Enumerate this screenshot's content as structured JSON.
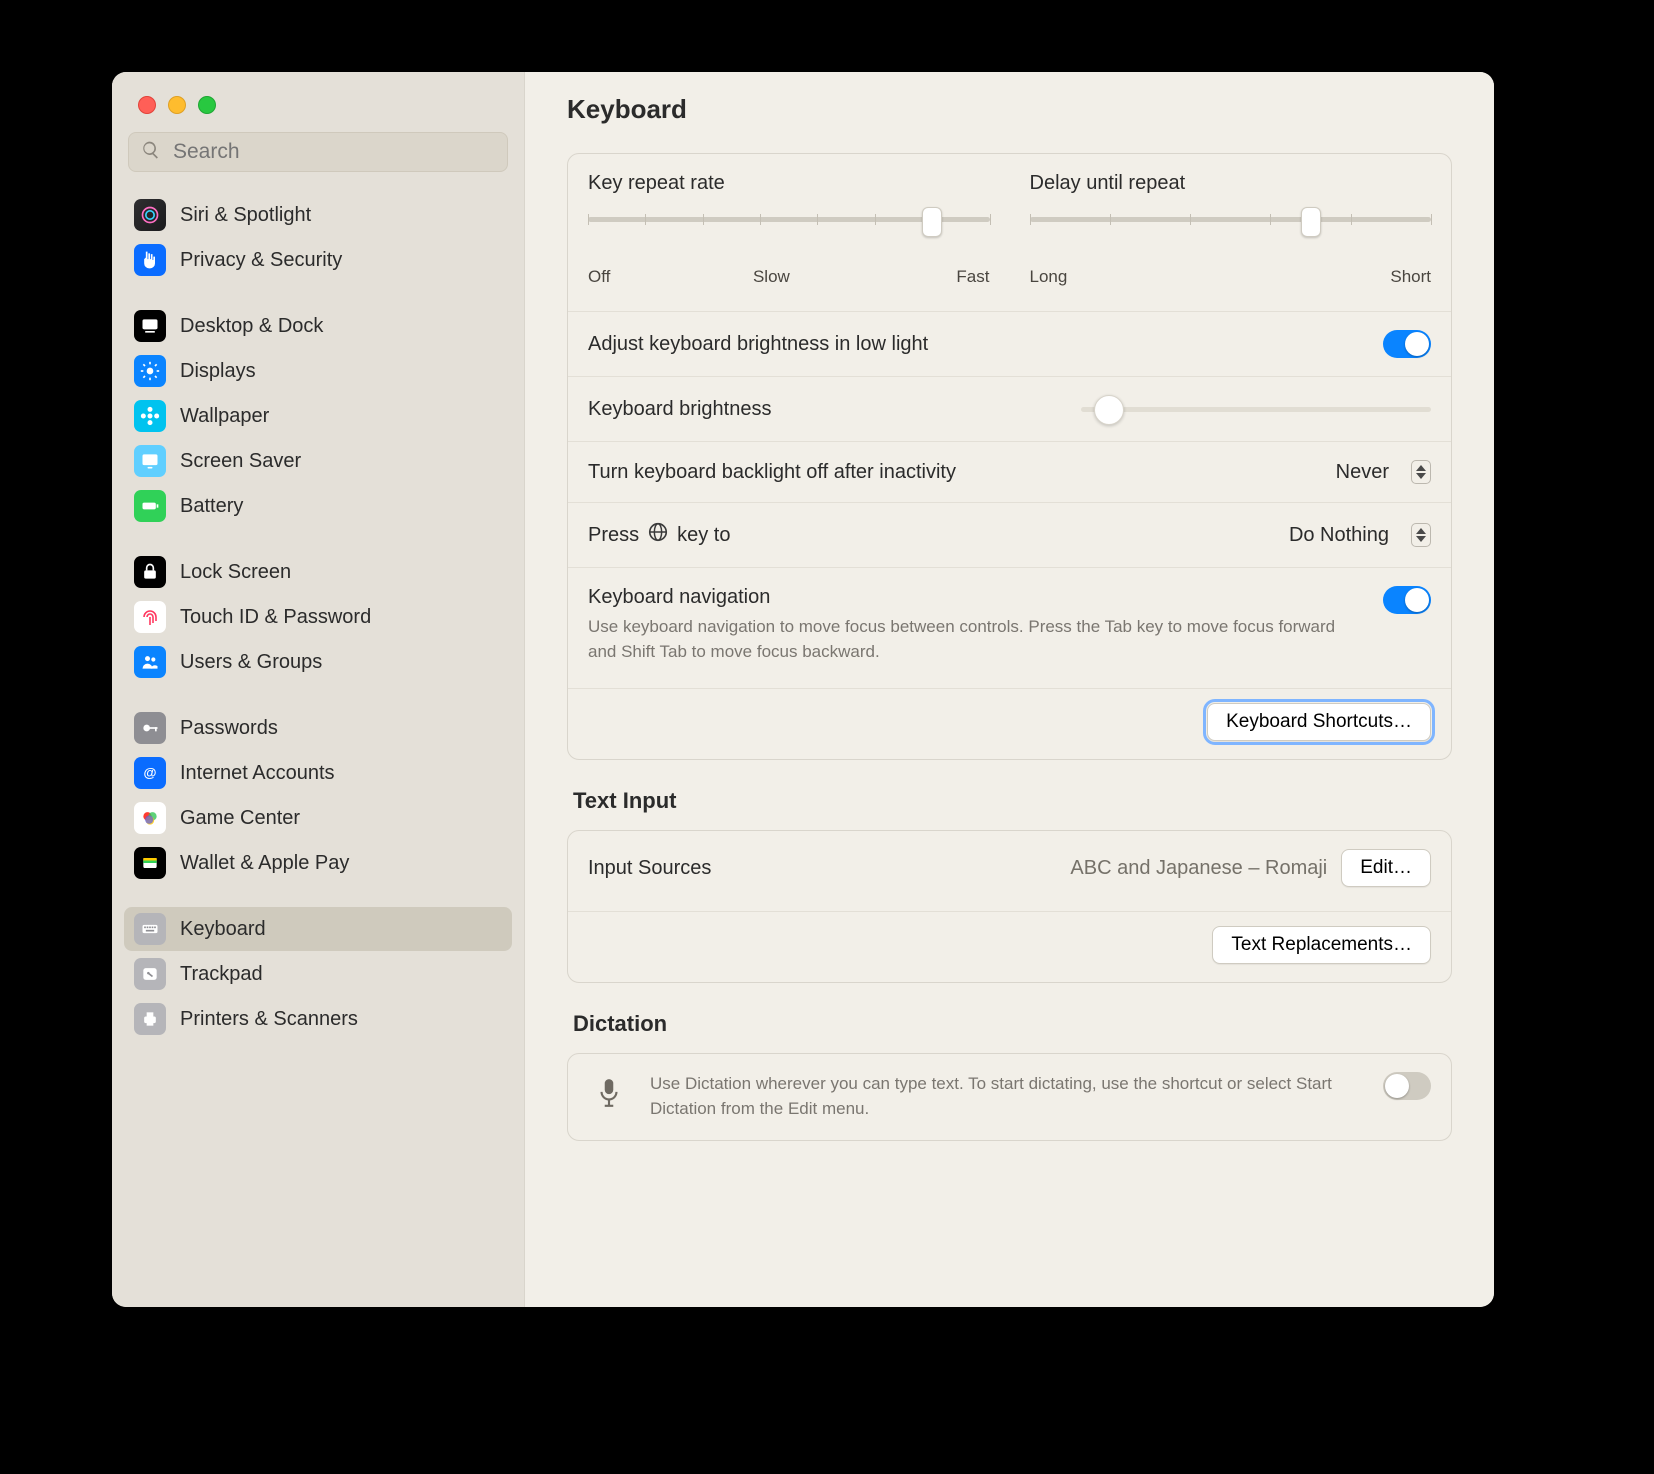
{
  "header": {
    "title": "Keyboard"
  },
  "search": {
    "placeholder": "Search"
  },
  "sidebar": {
    "groups": [
      {
        "items": [
          {
            "id": "siri",
            "label": "Siri & Spotlight"
          },
          {
            "id": "privacy",
            "label": "Privacy & Security"
          }
        ]
      },
      {
        "items": [
          {
            "id": "desktop",
            "label": "Desktop & Dock"
          },
          {
            "id": "displays",
            "label": "Displays"
          },
          {
            "id": "wallpaper",
            "label": "Wallpaper"
          },
          {
            "id": "screensaver",
            "label": "Screen Saver"
          },
          {
            "id": "battery",
            "label": "Battery"
          }
        ]
      },
      {
        "items": [
          {
            "id": "lock",
            "label": "Lock Screen"
          },
          {
            "id": "touchid",
            "label": "Touch ID & Password"
          },
          {
            "id": "users",
            "label": "Users & Groups"
          }
        ]
      },
      {
        "items": [
          {
            "id": "passwords",
            "label": "Passwords"
          },
          {
            "id": "internet",
            "label": "Internet Accounts"
          },
          {
            "id": "gamecenter",
            "label": "Game Center"
          },
          {
            "id": "wallet",
            "label": "Wallet & Apple Pay"
          }
        ]
      },
      {
        "items": [
          {
            "id": "keyboard",
            "label": "Keyboard",
            "selected": true
          },
          {
            "id": "trackpad",
            "label": "Trackpad"
          },
          {
            "id": "printers",
            "label": "Printers & Scanners"
          }
        ]
      }
    ]
  },
  "sliders": {
    "key_repeat": {
      "title": "Key repeat rate",
      "labels": [
        "Off",
        "Slow",
        "Fast"
      ],
      "ticks": 8,
      "value_index": 6
    },
    "delay_repeat": {
      "title": "Delay until repeat",
      "labels": [
        "Long",
        "Short"
      ],
      "ticks": 6,
      "value_index": 3.5
    }
  },
  "rows": {
    "auto_brightness": {
      "title": "Adjust keyboard brightness in low light",
      "on": true
    },
    "brightness_slider": {
      "title": "Keyboard brightness",
      "percent": 8
    },
    "backlight_off": {
      "title": "Turn keyboard backlight off after inactivity",
      "value": "Never"
    },
    "globe": {
      "prefix": "Press",
      "suffix": "key to",
      "value": "Do Nothing"
    },
    "nav": {
      "title": "Keyboard navigation",
      "sub": "Use keyboard navigation to move focus between controls. Press the Tab key to move focus forward and Shift Tab to move focus backward.",
      "on": true
    },
    "shortcuts_btn": "Keyboard Shortcuts…"
  },
  "text_input": {
    "section": "Text Input",
    "input_sources": {
      "title": "Input Sources",
      "value": "ABC and Japanese – Romaji",
      "edit": "Edit…"
    },
    "replacements_btn": "Text Replacements…"
  },
  "dictation": {
    "section": "Dictation",
    "desc": "Use Dictation wherever you can type text. To start dictating, use the shortcut or select Start Dictation from the Edit menu.",
    "on": false
  }
}
